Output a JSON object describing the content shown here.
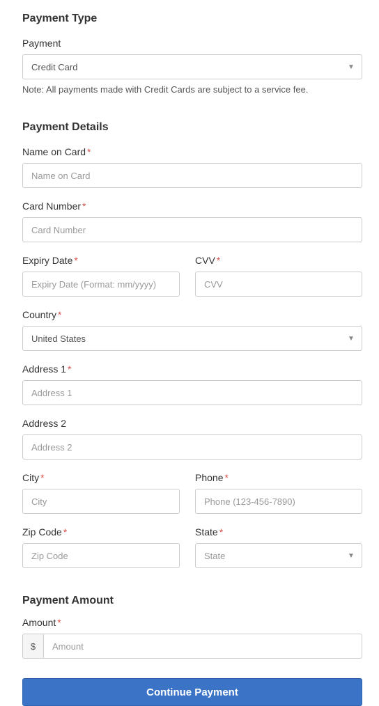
{
  "paymentType": {
    "heading": "Payment Type",
    "paymentLabel": "Payment",
    "paymentValue": "Credit Card",
    "note": "Note: All payments made with Credit Cards are subject to a service fee."
  },
  "paymentDetails": {
    "heading": "Payment Details",
    "nameOnCard": {
      "label": "Name on Card",
      "placeholder": "Name on Card"
    },
    "cardNumber": {
      "label": "Card Number",
      "placeholder": "Card Number"
    },
    "expiry": {
      "label": "Expiry Date",
      "placeholder": "Expiry Date (Format: mm/yyyy)"
    },
    "cvv": {
      "label": "CVV",
      "placeholder": "CVV"
    },
    "country": {
      "label": "Country",
      "value": "United States"
    },
    "address1": {
      "label": "Address 1",
      "placeholder": "Address 1"
    },
    "address2": {
      "label": "Address 2",
      "placeholder": "Address 2"
    },
    "city": {
      "label": "City",
      "placeholder": "City"
    },
    "phone": {
      "label": "Phone",
      "placeholder": "Phone (123-456-7890)"
    },
    "zip": {
      "label": "Zip Code",
      "placeholder": "Zip Code"
    },
    "state": {
      "label": "State",
      "value": "State"
    }
  },
  "paymentAmount": {
    "heading": "Payment Amount",
    "amountLabel": "Amount",
    "currencySymbol": "$",
    "placeholder": "Amount"
  },
  "submitLabel": "Continue Payment",
  "requiredMark": "*"
}
